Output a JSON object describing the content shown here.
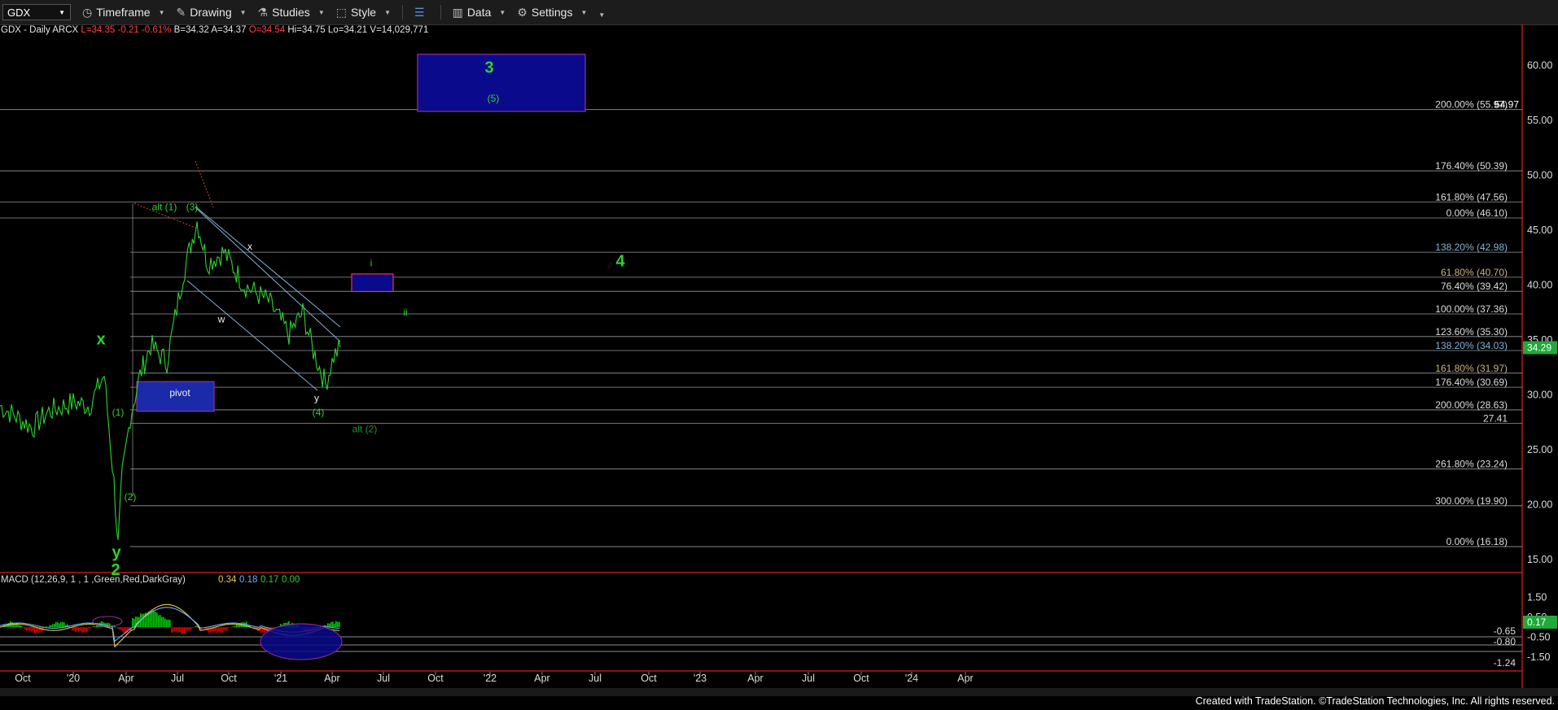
{
  "toolbar": {
    "symbol": "GDX",
    "items": [
      {
        "label": "Timeframe",
        "icon": "clock-icon"
      },
      {
        "label": "Drawing",
        "icon": "pen-icon"
      },
      {
        "label": "Studies",
        "icon": "flask-icon"
      },
      {
        "label": "Style",
        "icon": "style-icon"
      },
      {
        "label": "Data",
        "icon": "bars-icon"
      },
      {
        "label": "Settings",
        "icon": "gear-icon"
      }
    ]
  },
  "info": {
    "title": "GDX - Daily  ARCX",
    "last": "L=34.35",
    "change": "-0.21",
    "pct": "-0.61%",
    "bid": "B=34.32",
    "ask": "A=34.37",
    "open": "O=34.54",
    "high": "Hi=34.75",
    "low": "Lo=34.21",
    "volume": "V=14,029,771"
  },
  "colors": {
    "wave_green": "#2bd42b",
    "fib_blue": "#7fb3d9",
    "fib_white": "#dddddd",
    "fib_tan": "#c9b37a",
    "price_blue": "#4d6ee0",
    "box_blue": "#0a0a8c",
    "macd_green": "#00c800",
    "macd_red": "#e00000"
  },
  "footer": "Created with TradeStation. ©TradeStation Technologies, Inc. All rights reserved.",
  "chart_data": {
    "type": "line",
    "symbol": "GDX",
    "interval": "Daily",
    "ylim": [
      13.0,
      61.5
    ],
    "y_ticks": [
      "60.00",
      "55.00",
      "50.00",
      "45.00",
      "40.00",
      "35.00",
      "30.00",
      "25.00",
      "20.00",
      "15.00"
    ],
    "x_ticks": [
      "Oct",
      "'20",
      "Apr",
      "Jul",
      "Oct",
      "'21",
      "Apr",
      "Jul",
      "Oct",
      "'22",
      "Apr",
      "Jul",
      "Oct",
      "'23",
      "Apr",
      "Jul",
      "Oct",
      "'24",
      "Apr"
    ],
    "current_price": "34.29",
    "price_series": [
      [
        "Sep",
        29.0
      ],
      [
        "Oct",
        28.0
      ],
      [
        "Nov",
        27.0
      ],
      [
        "Dec",
        28.5
      ],
      [
        "'20",
        29.3
      ],
      [
        "Feb",
        29.0
      ],
      [
        "Feb-end",
        31.8
      ],
      [
        "Mar-a",
        22.0
      ],
      [
        "Mar-b",
        16.2
      ],
      [
        "Mar-c",
        22.5
      ],
      [
        "Apr",
        28.0
      ],
      [
        "Apr-b",
        31.8
      ],
      [
        "May",
        34.5
      ],
      [
        "Jun",
        33.0
      ],
      [
        "Jul",
        41.0
      ],
      [
        "Aug",
        45.8
      ],
      [
        "Aug-b",
        42.0
      ],
      [
        "Sep",
        43.0
      ],
      [
        "Oct",
        40.0
      ],
      [
        "Nov",
        38.5
      ],
      [
        "Dec",
        35.5
      ],
      [
        "'21",
        37.5
      ],
      [
        "Feb",
        34.0
      ],
      [
        "Mar",
        31.0
      ],
      [
        "Apr",
        33.5
      ],
      [
        "Apr-end",
        34.3
      ]
    ],
    "fib_levels": [
      {
        "label": "200.00% (55.97)",
        "value": 55.97,
        "color": "white",
        "extra_label": "54.97"
      },
      {
        "label": "176.40% (50.39)",
        "value": 50.39,
        "color": "white"
      },
      {
        "label": "161.80% (47.56)",
        "value": 47.56,
        "color": "white"
      },
      {
        "label": "0.00% (46.10)",
        "value": 46.1,
        "color": "white"
      },
      {
        "label": "138.20% (42.98)",
        "value": 42.98,
        "color": "blue"
      },
      {
        "label": "61.80% (40.70)",
        "value": 40.7,
        "color": "tan"
      },
      {
        "label": "76.40% (39.42)",
        "value": 39.42,
        "color": "white"
      },
      {
        "label": "100.00% (37.36)",
        "value": 37.36,
        "color": "white"
      },
      {
        "label": "123.60% (35.30)",
        "value": 35.3,
        "color": "white"
      },
      {
        "label": "138.20% (34.03)",
        "value": 34.03,
        "color": "blue"
      },
      {
        "label": "161.80% (31.97)",
        "value": 31.97,
        "color": "tan"
      },
      {
        "label": "176.40% (30.69)",
        "value": 30.69,
        "color": "white"
      },
      {
        "label": "200.00% (28.63)",
        "value": 28.63,
        "color": "white"
      },
      {
        "label": "27.41",
        "value": 27.41,
        "color": "white"
      },
      {
        "label": "261.80% (23.24)",
        "value": 23.24,
        "color": "white"
      },
      {
        "label": "300.00% (19.90)",
        "value": 19.9,
        "color": "white"
      },
      {
        "label": "0.00% (16.18)",
        "value": 16.18,
        "color": "white"
      }
    ],
    "annotations": [
      {
        "text": "3",
        "size": "big",
        "at": [
          "Nov 2021",
          59.3
        ]
      },
      {
        "text": "(5)",
        "size": "small",
        "at": [
          "Nov 2021",
          56.7
        ]
      },
      {
        "text": "alt (1)",
        "size": "small",
        "at": [
          "May 2020",
          46.8
        ]
      },
      {
        "text": "(3)",
        "size": "small",
        "at": [
          "Jul 2020",
          46.8
        ]
      },
      {
        "text": "x",
        "size": "white",
        "at": [
          "Oct 2020",
          43.2
        ]
      },
      {
        "text": "4",
        "size": "big",
        "at": [
          "Jun 2022",
          41.7
        ]
      },
      {
        "text": "i",
        "size": "small",
        "at": [
          "Jun 2021",
          41.7
        ]
      },
      {
        "text": "ii",
        "size": "small",
        "at": [
          "Aug 2021",
          37.2
        ]
      },
      {
        "text": "w",
        "size": "white",
        "at": [
          "Sep 2020",
          36.6
        ]
      },
      {
        "text": "x",
        "size": "big",
        "at": [
          "Feb 2020",
          34.6
        ]
      },
      {
        "text": "pivot",
        "size": "white",
        "at": [
          "May 2020",
          29.9
        ]
      },
      {
        "text": "y",
        "size": "white",
        "at": [
          "Mar 2021",
          29.4
        ]
      },
      {
        "text": "(4)",
        "size": "small",
        "at": [
          "Mar 2021",
          28.1
        ]
      },
      {
        "text": "alt (2)",
        "size": "small",
        "at": [
          "May 2021",
          26.6
        ]
      },
      {
        "text": "(1)",
        "size": "small",
        "at": [
          "Mar 2020",
          28.1
        ]
      },
      {
        "text": "(2)",
        "size": "small",
        "at": [
          "Apr 2020",
          20.4
        ]
      },
      {
        "text": "y",
        "size": "big",
        "at": [
          "Mar 2020",
          15.2
        ]
      },
      {
        "text": "2",
        "size": "big",
        "at": [
          "Mar 2020",
          13.6
        ]
      }
    ],
    "target_boxes": [
      {
        "name": "wave-3-target",
        "y_range": [
          55.8,
          61.0
        ]
      },
      {
        "name": "wave-i-target",
        "y_range": [
          39.4,
          41.0
        ]
      },
      {
        "name": "pivot-box",
        "y_range": [
          28.5,
          31.2
        ]
      }
    ],
    "macd": {
      "label": "MACD (12,26,9, 1 , 1 ,Green,Red,DarkGray)",
      "values": [
        "0.34",
        "0.18",
        "0.17",
        "0.00"
      ],
      "ylim": [
        -1.9,
        2.0
      ],
      "y_ticks": [
        "1.50",
        "0.50",
        "-0.50",
        "-1.50"
      ],
      "level_labels": [
        "-0.65",
        "-0.80",
        "-1.24"
      ],
      "current": "0.17"
    }
  }
}
